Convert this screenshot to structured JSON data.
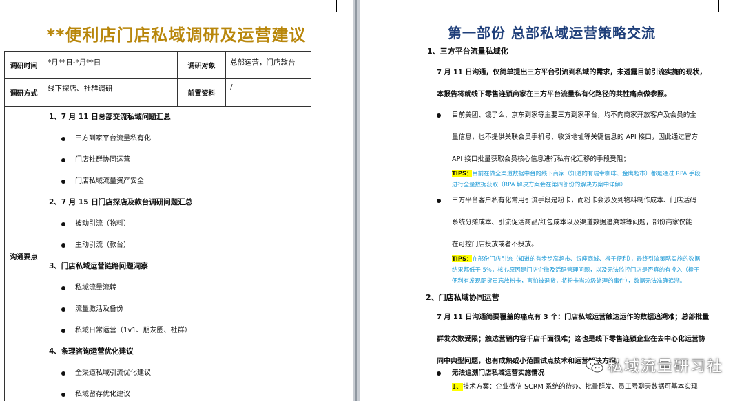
{
  "left_page": {
    "title": "**便利店门店私域调研及运营建议",
    "row1": {
      "label_a": "调研时间",
      "value_a": "*月**日-*月**日",
      "label_b": "调研对象",
      "value_b": "总部运营，门店款台"
    },
    "row2": {
      "label_a": "调研方式",
      "value_a": "线下探店、社群调研",
      "label_b": "前置资料",
      "value_b": "/"
    },
    "section_label": "沟通要点",
    "outline": [
      {
        "heading": "1、7 月 11 日总部交流私域问题汇总",
        "items": [
          "三方到家平台流量私有化",
          "门店社群协同运营",
          "门店私域流量资产安全"
        ]
      },
      {
        "heading": "2、7 月 15 日门店探店及款台调研问题汇总",
        "items": [
          "被动引流（物料）",
          "主动引流（款台）"
        ]
      },
      {
        "heading": "3、门店私域运营链路问题洞察",
        "items": [
          "私域流量流转",
          "流量激活及备份",
          "私域日常运营（1v1、朋友圈、社群）"
        ]
      },
      {
        "heading": "4、条理咨询运营优化建议",
        "items": [
          "全渠道私域引流优化建议",
          "私域留存优化建议"
        ]
      }
    ]
  },
  "right_page": {
    "title": "第一部份  总部私域运营策略交流",
    "s1_heading": "1、三方平台流量私域化",
    "s1_intro": [
      "7 月 11 日沟通，仅简单提出三方平台引流到私域的需求，未透露目前引流实施的现状，",
      "本报告将就线下零售连锁商家在三方平台流量私有化路径的共性痛点做参照。"
    ],
    "bullet1": [
      "目前美团、饿了么、京东到家等主要三方到家平台，均不向商家开放客户及会员的全",
      "量信息，也不提供关联会员手机号、收货地址等关键信息的 API 接口，因此通过官方",
      "API 接口批量获取会员核心信息进行私有化迁移的手段受阻；"
    ],
    "tips1_label": "TIPS：",
    "tips1": [
      "目前在做全渠道数据中台的线下商家（知道的有瑞幸咖啡、金鹰超市）都是通过 RPA 手段",
      "进行全量数据获取（RPA 解决方案会在第四部份的解决方案中详解）"
    ],
    "bullet2": [
      "三方平台客户私有化常用引流手段是粉卡，而粉卡会涉及到物料制作成本、门店活码",
      "系统分摊成本、引流促活商品/红包成本以及渠道数据追溯难等问题，部份商家仅能",
      "在可控门店投放或者不投放。"
    ],
    "tips2_label": "TIPS：",
    "tips2": [
      "在部份门店引流（知道的有步步高超市、银座商城、橙子便利），最终引流策略实施的数据",
      "结果都低于 5%，核心原因是门店企微及活码管理问题，以及无法监控门店是否真的有投入（橙子",
      "便利有发现配货员忘放粉卡，害怕被退货，将粉卡当垃圾处理的事件），数据无法准确追溯。"
    ],
    "s2_heading": "2、门店私域协同运营",
    "s2_para": [
      "7 月 11 日沟通简要覆盖的痛点有 3 个：门店私域运营触达运作的数据追溯难；总部批量",
      "群发次数受限；触达营销内容千店千面很难；这也是线下零售连锁企业在去中心化运营协",
      "同中典型问题，也有成熟或小范围试点技术和运营解决方案。"
    ],
    "s2_bullet": "无法追溯门店私域运营实施情况",
    "s2_sub_num": "1、",
    "s2_sub": "技术方案：企业微信 SCRM 系统的待办、批量群发、员工号聊天数据可基本实现"
  },
  "watermark": "私域流量研习社",
  "colors": {
    "left_title": "#b8860b",
    "right_title": "#1f3f7a",
    "tips": "#1e9ad6",
    "highlight": "#ffff00"
  }
}
